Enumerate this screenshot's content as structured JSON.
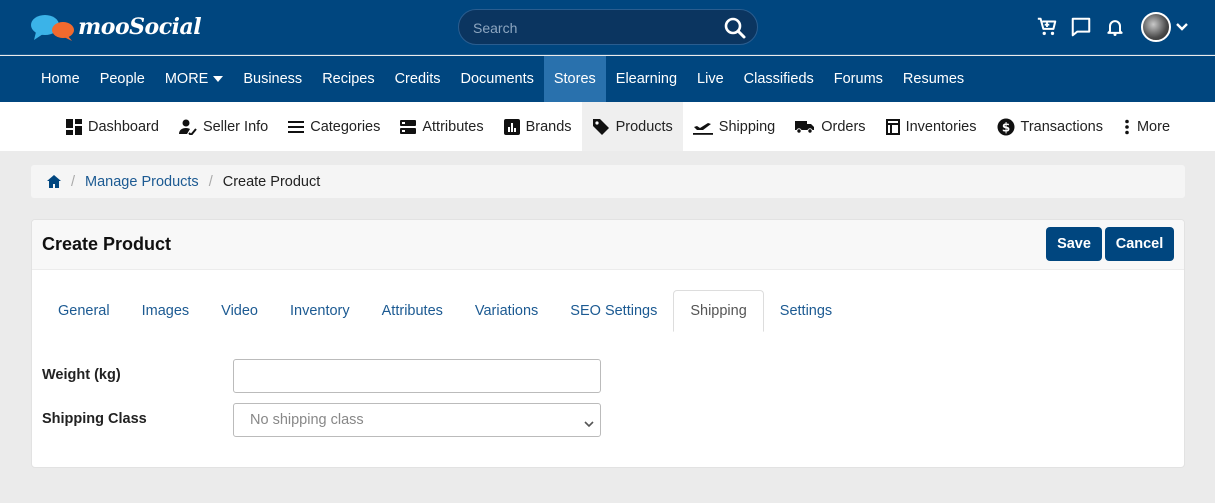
{
  "header": {
    "logo_text": "mooSocial",
    "search": {
      "placeholder": "Search"
    }
  },
  "main_nav": [
    "Home",
    "People",
    "MORE",
    "Business",
    "Recipes",
    "Credits",
    "Documents",
    "Stores",
    "Elearning",
    "Live",
    "Classifieds",
    "Forums",
    "Resumes"
  ],
  "main_nav_active": "Stores",
  "store_nav": [
    {
      "label": "Dashboard",
      "icon": "dashboard-icon"
    },
    {
      "label": "Seller Info",
      "icon": "seller-icon"
    },
    {
      "label": "Categories",
      "icon": "list-icon"
    },
    {
      "label": "Attributes",
      "icon": "attributes-icon"
    },
    {
      "label": "Brands",
      "icon": "brands-icon"
    },
    {
      "label": "Products",
      "icon": "tag-icon"
    },
    {
      "label": "Shipping",
      "icon": "plane-icon"
    },
    {
      "label": "Orders",
      "icon": "truck-icon"
    },
    {
      "label": "Inventories",
      "icon": "inventory-icon"
    },
    {
      "label": "Transactions",
      "icon": "dollar-icon"
    },
    {
      "label": "More",
      "icon": "dots-vertical-icon"
    }
  ],
  "store_nav_active": "Products",
  "breadcrumb": {
    "link": "Manage Products",
    "current": "Create Product"
  },
  "card": {
    "title": "Create Product",
    "save_label": "Save",
    "cancel_label": "Cancel"
  },
  "tabs": [
    "General",
    "Images",
    "Video",
    "Inventory",
    "Attributes",
    "Variations",
    "SEO Settings",
    "Shipping",
    "Settings"
  ],
  "tab_active": "Shipping",
  "form": {
    "weight_label": "Weight (kg)",
    "weight_value": "",
    "shipping_class_label": "Shipping Class",
    "shipping_class_value": "No shipping class"
  },
  "colors": {
    "header_bg": "#00467f",
    "active_nav_bg": "#2971ad",
    "link": "#1c5a92"
  }
}
